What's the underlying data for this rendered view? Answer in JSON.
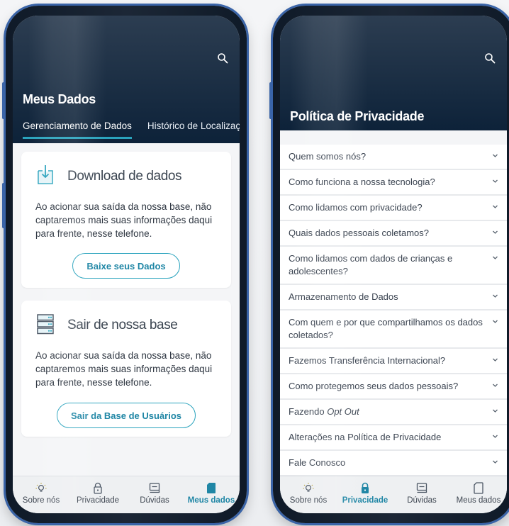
{
  "left_screen": {
    "header_title": "Meus Dados",
    "tabs": [
      {
        "label": "Gerenciamento de Dados"
      },
      {
        "label": "Histórico de Localizaçã"
      }
    ],
    "download_card": {
      "title": "Download de dados",
      "text": "Ao acionar sua saída da nossa base, não captaremos mais suas informações daqui para frente, nesse telefone.",
      "button": "Baixe seus Dados",
      "icon": "download-icon"
    },
    "exit_card": {
      "title": "Sair de nossa base",
      "text": "Ao acionar sua saída da nossa base, não captaremos mais suas informações daqui para frente, nesse telefone.",
      "button": "Sair da Base de Usuários",
      "icon": "server-icon"
    }
  },
  "right_screen": {
    "header_title": "Política de Privacidade",
    "faq": [
      {
        "label": "Quem somos nós?"
      },
      {
        "label": "Como funciona a nossa tecnologia?"
      },
      {
        "label": "Como lidamos com privacidade?"
      },
      {
        "label": "Quais dados pessoais coletamos?"
      },
      {
        "label": "Como lidamos com dados de crianças e adolescentes?"
      },
      {
        "label": "Armazenamento de Dados"
      },
      {
        "label": "Com quem e por que compartilhamos os dados coletados?"
      },
      {
        "label": "Fazemos Transferência Internacional?"
      },
      {
        "label": "Como protegemos seus dados pessoais?"
      },
      {
        "label": "Fazendo Opt Out"
      },
      {
        "label": "Alterações na Política de Privacidade"
      },
      {
        "label": "Fale Conosco"
      }
    ]
  },
  "nav": {
    "items": [
      {
        "label": "Sobre nós",
        "icon": "lightbulb-icon"
      },
      {
        "label": "Privacidade",
        "icon": "lock-icon"
      },
      {
        "label": "Dúvidas",
        "icon": "chat-icon"
      },
      {
        "label": "Meus dados",
        "icon": "sd-card-icon"
      }
    ],
    "left_active": "Meus dados",
    "right_active": "Privacidade"
  },
  "colors": {
    "header_dark": "#0d2239",
    "accent_teal": "#2aa3bd",
    "phone_frame": "#3a64a8"
  }
}
